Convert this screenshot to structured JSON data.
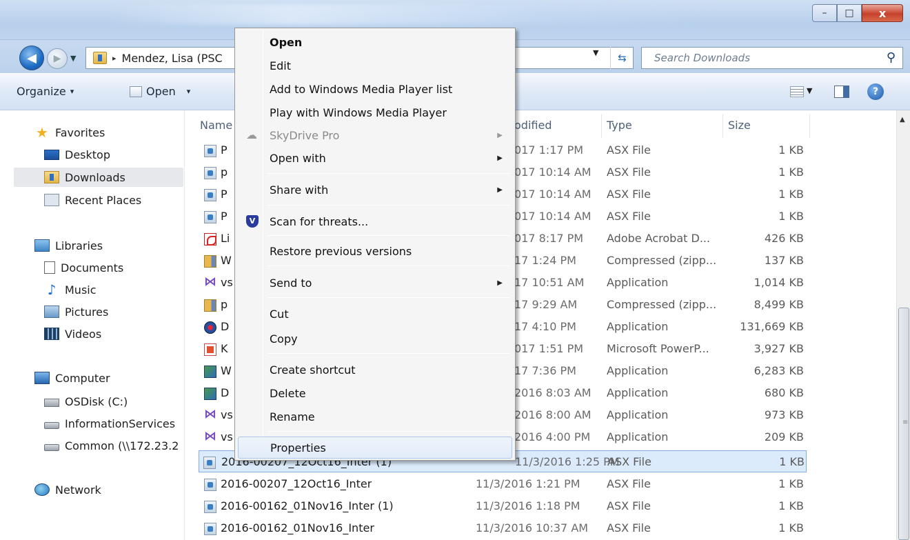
{
  "window": {
    "controls": {
      "minimize": "–",
      "maximize": "□",
      "close": "x"
    }
  },
  "address": {
    "path": "Mendez, Lisa (PSC",
    "separator": "▸",
    "search_placeholder": "Search Downloads"
  },
  "toolbar": {
    "organize_label": "Organize",
    "open_label": "Open",
    "dropdown_arrow": "▾"
  },
  "nav": {
    "favorites_label": "Favorites",
    "desktop_label": "Desktop",
    "downloads_label": "Downloads",
    "recent_label": "Recent Places",
    "libraries_label": "Libraries",
    "documents_label": "Documents",
    "music_label": "Music",
    "pictures_label": "Pictures",
    "videos_label": "Videos",
    "computer_label": "Computer",
    "osdisk_label": "OSDisk (C:)",
    "infoservices_label": "InformationServices",
    "common_label": "Common (\\\\172.23.2",
    "network_label": "Network"
  },
  "columns": {
    "name": "Name",
    "modified": "odified",
    "type": "Type",
    "size": "Size"
  },
  "files": [
    {
      "name": "P",
      "date": "017 1:17 PM",
      "type": "ASX File",
      "size": "1 KB",
      "icon": "asx-icon"
    },
    {
      "name": "p",
      "date": "017 10:14 AM",
      "type": "ASX File",
      "size": "1 KB",
      "icon": "asx-icon"
    },
    {
      "name": "P",
      "date": "017 10:14 AM",
      "type": "ASX File",
      "size": "1 KB",
      "icon": "asx-icon"
    },
    {
      "name": "P",
      "date": "017 10:14 AM",
      "type": "ASX File",
      "size": "1 KB",
      "icon": "asx-icon"
    },
    {
      "name": "Li",
      "date": "017 8:17 PM",
      "type": "Adobe Acrobat D...",
      "size": "426 KB",
      "icon": "pdf-icon"
    },
    {
      "name": "W",
      "date": "17 1:24 PM",
      "type": "Compressed (zipp...",
      "size": "137 KB",
      "icon": "zip-icon"
    },
    {
      "name": "vs",
      "date": "17 10:51 AM",
      "type": "Application",
      "size": "1,014 KB",
      "icon": "visual-studio-icon"
    },
    {
      "name": "p",
      "date": "17 9:29 AM",
      "type": "Compressed (zipp...",
      "size": "8,499 KB",
      "icon": "zip-icon"
    },
    {
      "name": "D",
      "date": "17 4:10 PM",
      "type": "Application",
      "size": "131,669 KB",
      "icon": "application-icon"
    },
    {
      "name": "K",
      "date": "017 1:51 PM",
      "type": "Microsoft PowerP...",
      "size": "3,927 KB",
      "icon": "powerpoint-icon"
    },
    {
      "name": "W",
      "date": "17 7:36 PM",
      "type": "Application",
      "size": "6,283 KB",
      "icon": "setup-icon"
    },
    {
      "name": "D",
      "date": "2016 8:03 AM",
      "type": "Application",
      "size": "680 KB",
      "icon": "setup-icon"
    },
    {
      "name": "vs",
      "date": "2016 8:00 AM",
      "type": "Application",
      "size": "973 KB",
      "icon": "visual-studio-icon"
    },
    {
      "name": "vs",
      "date": "2016 4:00 PM",
      "type": "Application",
      "size": "209 KB",
      "icon": "visual-studio-icon"
    },
    {
      "name": "2016-00207_12Oct16_Inter (1)",
      "date": "11/3/2016 1:25 PM",
      "type": "ASX File",
      "size": "1 KB",
      "icon": "asx-icon"
    },
    {
      "name": "2016-00207_12Oct16_Inter",
      "date": "11/3/2016 1:21 PM",
      "type": "ASX File",
      "size": "1 KB",
      "icon": "asx-icon"
    },
    {
      "name": "2016-00162_01Nov16_Inter (1)",
      "date": "11/3/2016 1:18 PM",
      "type": "ASX File",
      "size": "1 KB",
      "icon": "asx-icon"
    },
    {
      "name": "2016-00162_01Nov16_Inter",
      "date": "11/3/2016 10:37 AM",
      "type": "ASX File",
      "size": "1 KB",
      "icon": "asx-icon"
    }
  ],
  "context_menu": {
    "open": "Open",
    "edit": "Edit",
    "add_wmp": "Add to Windows Media Player list",
    "play_wmp": "Play with Windows Media Player",
    "skydrive": "SkyDrive Pro",
    "open_with": "Open with",
    "share_with": "Share with",
    "scan": "Scan for threats...",
    "restore": "Restore previous versions",
    "send_to": "Send to",
    "cut": "Cut",
    "copy": "Copy",
    "create_shortcut": "Create shortcut",
    "delete": "Delete",
    "rename": "Rename",
    "properties": "Properties",
    "submenu_arrow": "▶"
  }
}
